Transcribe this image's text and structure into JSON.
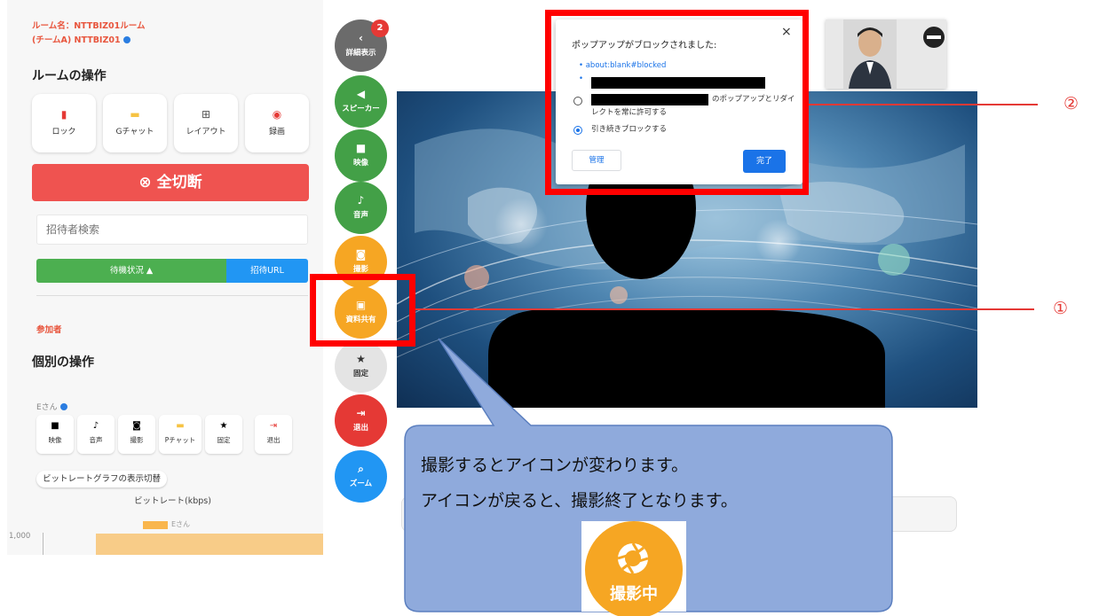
{
  "left_panel": {
    "room_line1": "ルーム名：NTTBIZ01ルーム",
    "room_line2": "(チームA) NTTBIZ01",
    "room_ops_title": "ルームの操作",
    "room_ops": [
      {
        "icon": "lock-icon",
        "glyph": "🔒",
        "label": "ロック",
        "color": "#e53935"
      },
      {
        "icon": "chat-icon",
        "glyph": "▬",
        "label": "Gチャット",
        "color": "#f6c343"
      },
      {
        "icon": "grid-icon",
        "glyph": "⊞",
        "label": "レイアウト",
        "color": "#555555"
      },
      {
        "icon": "record-icon",
        "glyph": "◉",
        "label": "録画",
        "color": "#e53935"
      }
    ],
    "disconnect_all": "⊗ 全切断",
    "search_placeholder": "招待者検索",
    "standby_label": "待機状況 ▲",
    "invite_url_label": "招待URL",
    "participants_label": "参加者",
    "individual_ops_title": "個別の操作",
    "person_label": "Eさん",
    "individual_ops": [
      {
        "icon": "video-icon",
        "glyph": "■",
        "label": "映像",
        "color": "#333333"
      },
      {
        "icon": "mic-icon",
        "glyph": "🎙",
        "label": "音声",
        "color": "#333333"
      },
      {
        "icon": "camera-icon",
        "glyph": "◙",
        "label": "撮影",
        "color": "#333333"
      },
      {
        "icon": "chat-icon",
        "glyph": "▬",
        "label": "Pチャット",
        "color": "#f6c343"
      },
      {
        "icon": "star-icon",
        "glyph": "★",
        "label": "固定",
        "color": "#333333"
      },
      {
        "icon": "exit-icon",
        "glyph": "⇥",
        "label": "退出",
        "color": "#e53935"
      }
    ],
    "bitrate_toggle": "ビットレートグラフの表示切替",
    "bitrate_title": "ビットレート(kbps)",
    "legend_label": "Eさん",
    "y_tick": "1,000"
  },
  "side_buttons": [
    {
      "name": "details-button",
      "icon": "chevron-left-icon",
      "glyph": "‹",
      "label": "詳細表示",
      "color": "#6b6b6b"
    },
    {
      "name": "speaker-button",
      "icon": "speaker-icon",
      "glyph": "◀)",
      "label": "スピーカー",
      "color": "#43a047"
    },
    {
      "name": "video-button",
      "icon": "video-icon",
      "glyph": "■",
      "label": "映像",
      "color": "#43a047"
    },
    {
      "name": "audio-button",
      "icon": "mic-icon",
      "glyph": "🎙",
      "label": "音声",
      "color": "#43a047"
    },
    {
      "name": "capture-button",
      "icon": "camera-icon",
      "glyph": "◙",
      "label": "撮影",
      "color": "#f6a623"
    },
    {
      "name": "share-button",
      "icon": "share-screen-icon",
      "glyph": "▣",
      "label": "資料共有",
      "color": "#f6a623"
    },
    {
      "name": "pin-button",
      "icon": "star-icon",
      "glyph": "★",
      "label": "固定",
      "color": "#e0e0e0"
    },
    {
      "name": "exit-button",
      "icon": "exit-icon",
      "glyph": "⇥",
      "label": "退出",
      "color": "#e53935"
    },
    {
      "name": "zoom-button",
      "icon": "zoom-icon",
      "glyph": "🔍",
      "label": "ズーム",
      "color": "#2196f3"
    }
  ],
  "badge_count": "2",
  "popup": {
    "title": "ポップアップがブロックされました:",
    "close": "×",
    "link1": "• about:blank#blocked",
    "bullet2": "•",
    "allow_text1": "のポップアップとリダイ",
    "allow_text2": "レクトを常に許可する",
    "block_text": "引き続きブロックする",
    "manage": "管理",
    "done": "完了"
  },
  "markers": {
    "one": "①",
    "two": "②"
  },
  "callout": {
    "line1": "撮影するとアイコンが変わります。",
    "line2": "アイコンが戻ると、撮影終了となります。",
    "icon_caption": "撮影中",
    "icon": "camera-shutter-icon"
  },
  "colors": {
    "annotation_red": "#ff0000",
    "callout_fill": "#8faadc",
    "accent_orange": "#f6a623"
  }
}
